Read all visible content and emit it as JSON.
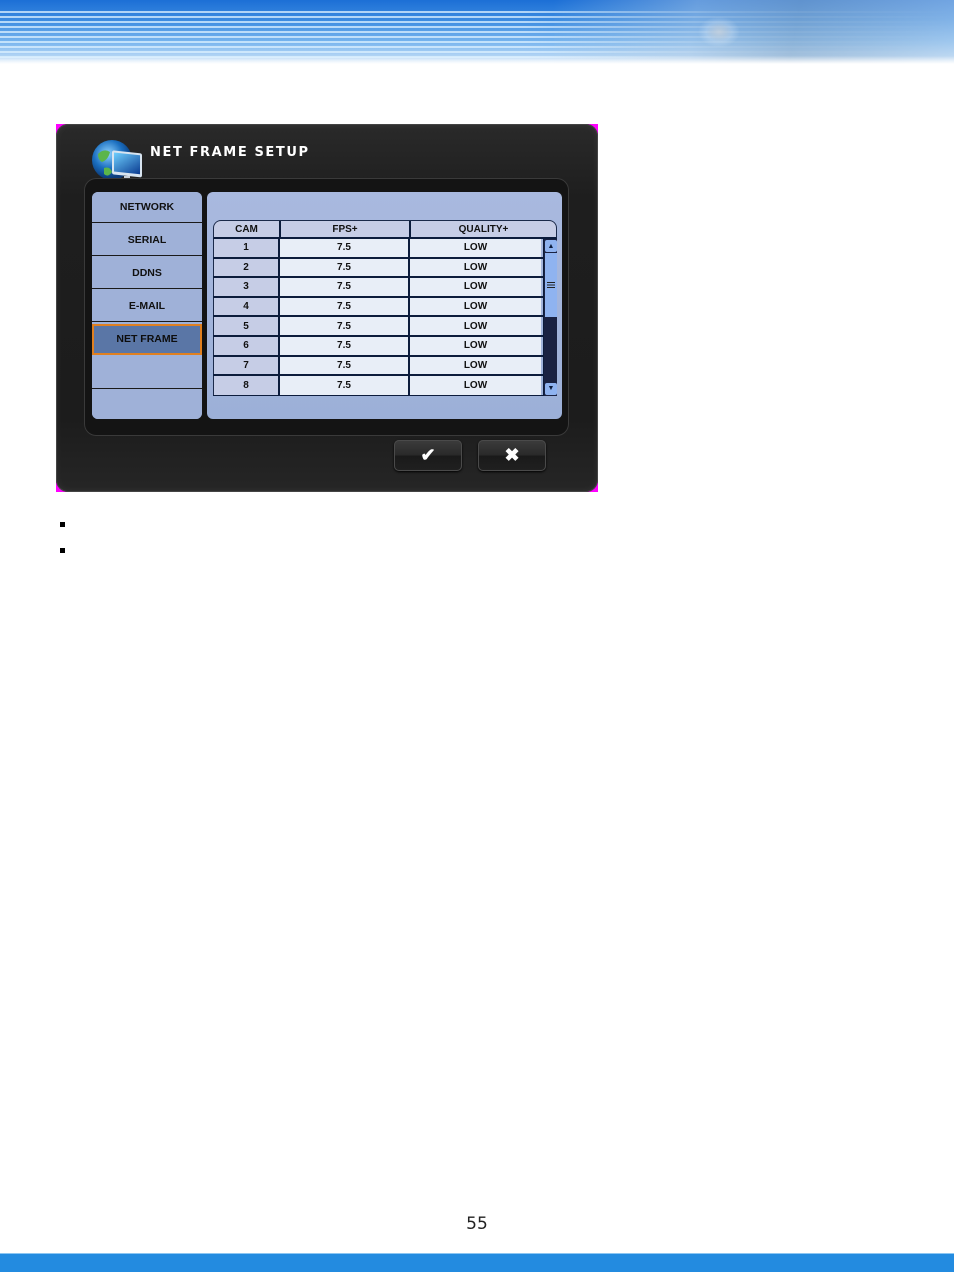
{
  "page": {
    "page_number": "55",
    "bullets": [
      "",
      ""
    ]
  },
  "dialog": {
    "title": "NET FRAME SETUP",
    "icon": "network-monitor-globe-icon",
    "sidebar": {
      "items": [
        {
          "label": "NETWORK",
          "active": false
        },
        {
          "label": "SERIAL",
          "active": false
        },
        {
          "label": "DDNS",
          "active": false
        },
        {
          "label": "E-MAIL",
          "active": false
        },
        {
          "label": "NET FRAME",
          "active": true
        },
        {
          "label": "",
          "active": false
        },
        {
          "label": "",
          "active": false
        }
      ]
    },
    "table": {
      "headers": [
        "CAM",
        "FPS+",
        "QUALITY+"
      ],
      "rows": [
        {
          "cam": "1",
          "fps": "7.5",
          "quality": "LOW"
        },
        {
          "cam": "2",
          "fps": "7.5",
          "quality": "LOW"
        },
        {
          "cam": "3",
          "fps": "7.5",
          "quality": "LOW"
        },
        {
          "cam": "4",
          "fps": "7.5",
          "quality": "LOW"
        },
        {
          "cam": "5",
          "fps": "7.5",
          "quality": "LOW"
        },
        {
          "cam": "6",
          "fps": "7.5",
          "quality": "LOW"
        },
        {
          "cam": "7",
          "fps": "7.5",
          "quality": "LOW"
        },
        {
          "cam": "8",
          "fps": "7.5",
          "quality": "LOW"
        }
      ],
      "scroll_position": 0
    },
    "buttons": {
      "ok_icon": "✔",
      "cancel_icon": "✖"
    }
  },
  "colors": {
    "banner_blue": "#1c6fd6",
    "footer_blue": "#238be0",
    "active_outline": "#e08020",
    "panel_blue": "#9fb1d8"
  }
}
